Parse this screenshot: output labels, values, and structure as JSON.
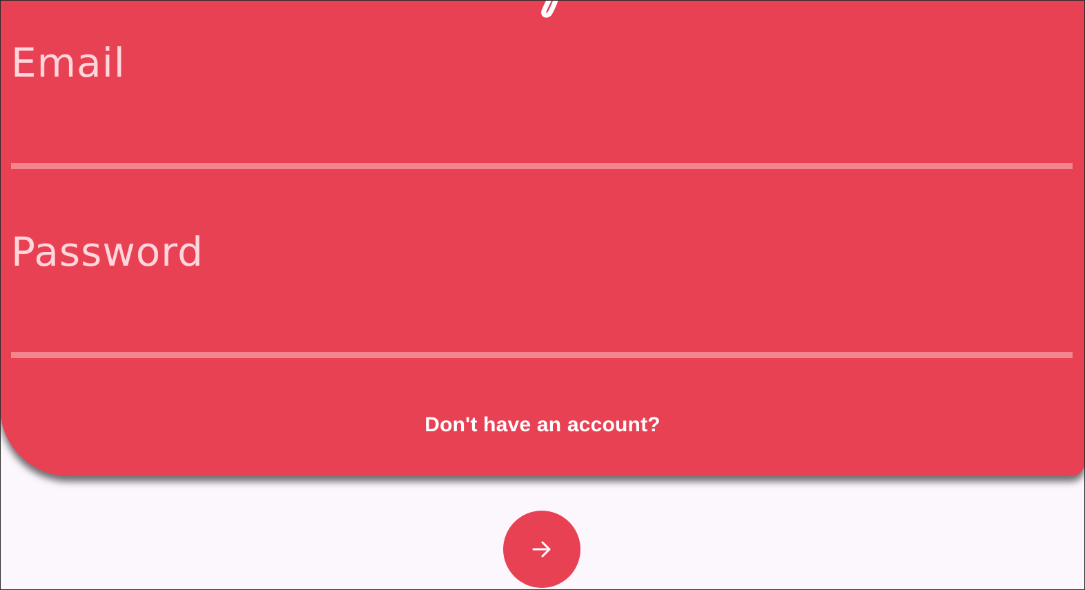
{
  "login_form": {
    "email": {
      "label": "Email",
      "value": "",
      "placeholder": ""
    },
    "password": {
      "label": "Password",
      "value": "",
      "placeholder": ""
    },
    "signup_prompt": "Don't have an account?"
  },
  "actions": {
    "submit_icon": "arrow-right-icon"
  },
  "colors": {
    "accent": "#e84153",
    "background": "#fcf6fd",
    "label_text": "#ffd6dc",
    "underline": "#f3858f",
    "link_text": "#ffffff"
  }
}
